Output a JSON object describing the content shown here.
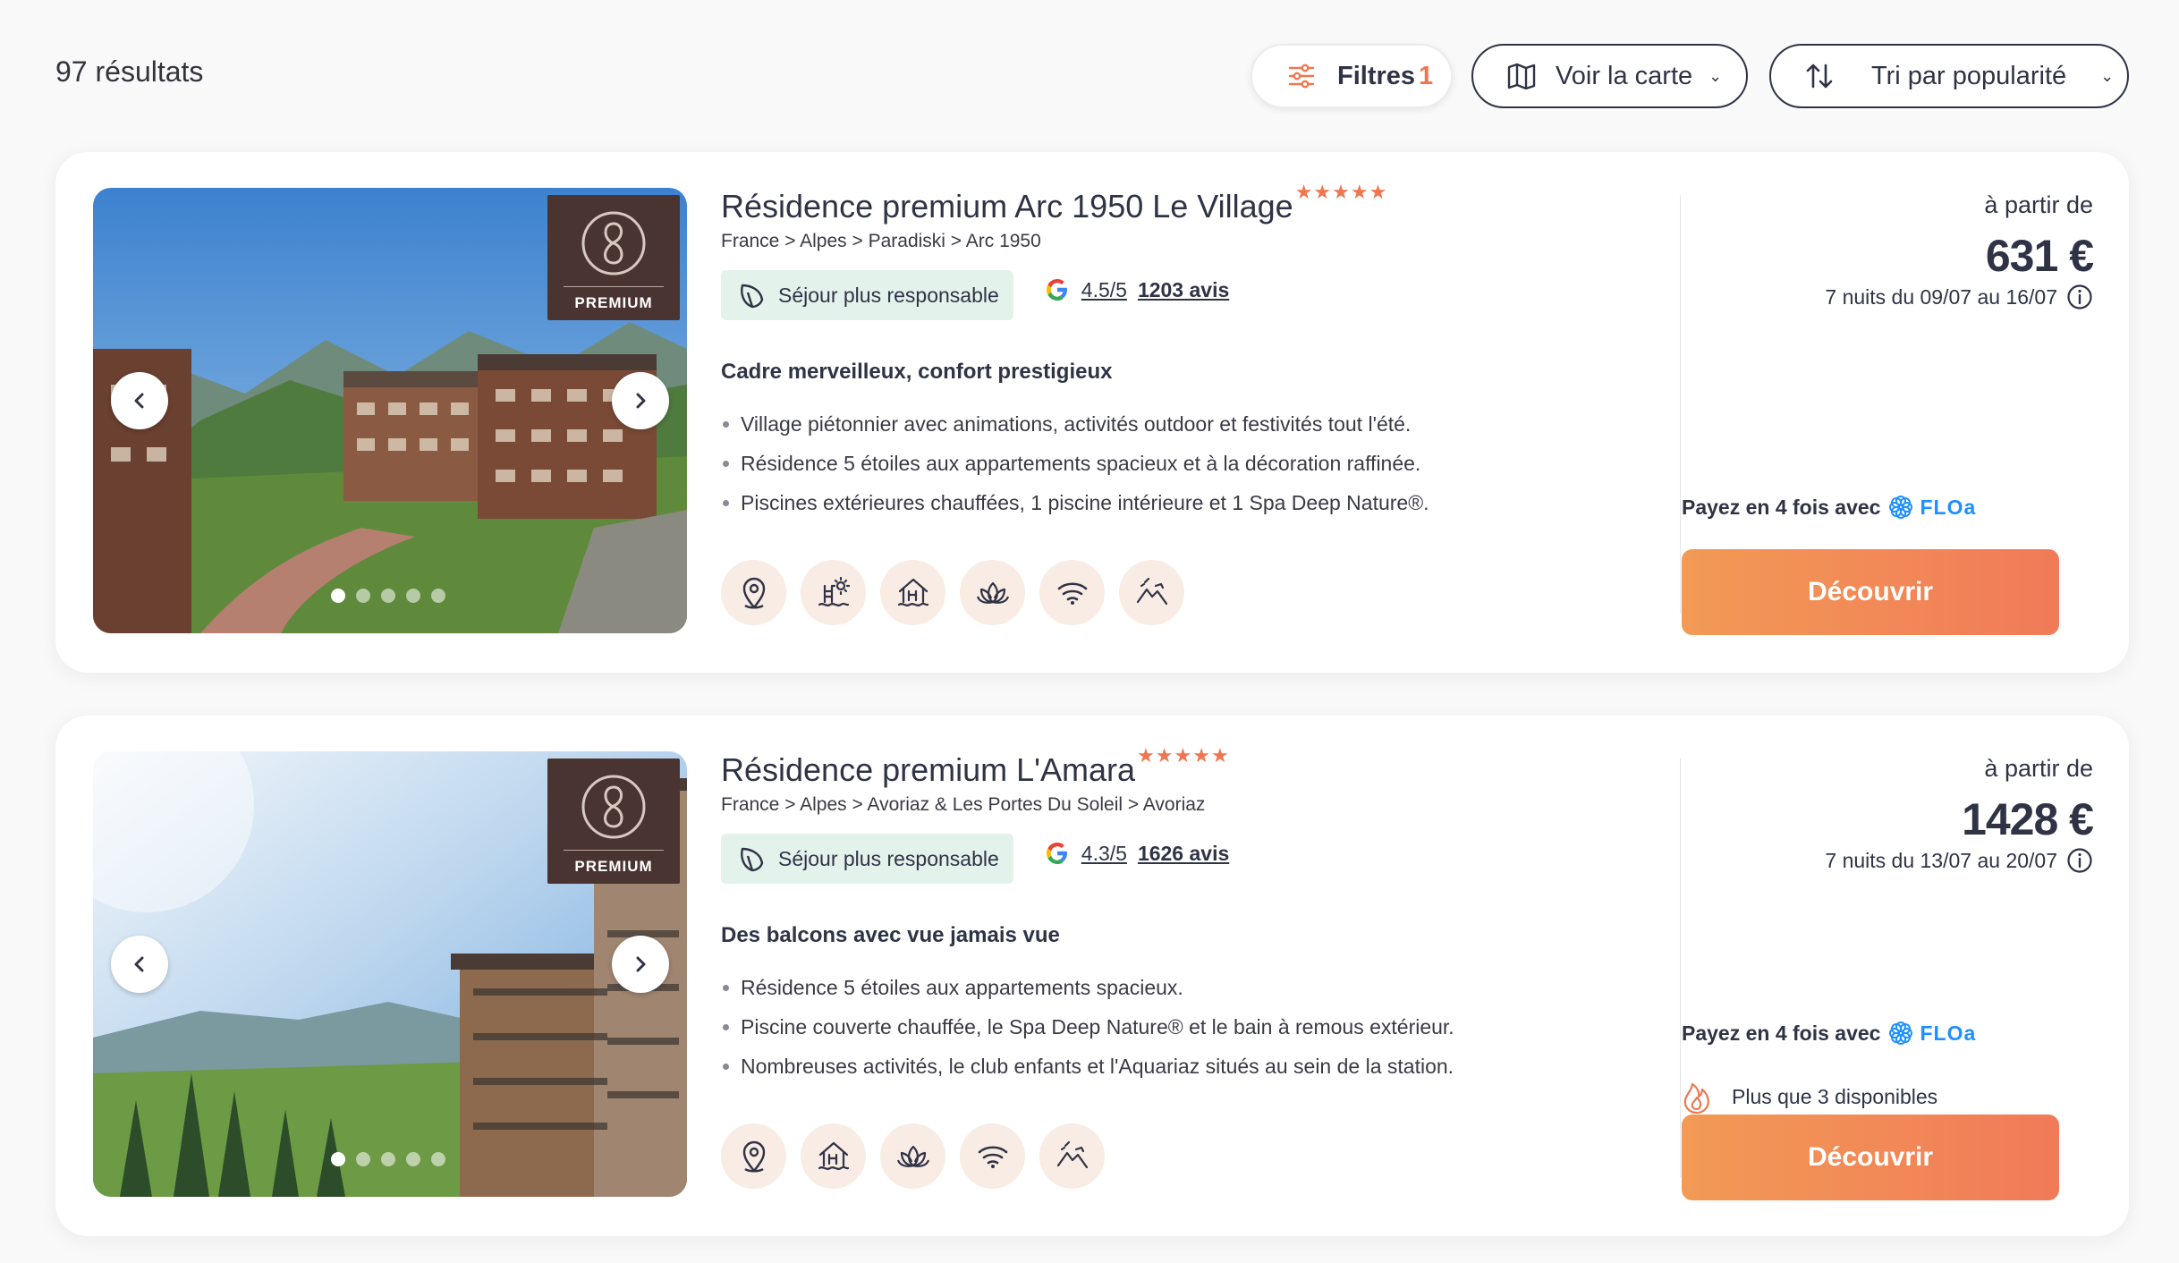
{
  "results": {
    "count_label": "97 résultats"
  },
  "toolbar": {
    "filters_label": "Filtres",
    "filters_count": "1",
    "map_label": "Voir la carte",
    "sort_label": "Tri par popularité"
  },
  "colors": {
    "accent": "#f07650",
    "button_start": "#f29a56",
    "button_end": "#f17a58",
    "eco_bg": "#e3f3ec",
    "badge_bg": "#4a3431",
    "text": "#2f3345"
  },
  "cards": [
    {
      "badge": "PREMIUM",
      "title": "Résidence premium Arc 1950 Le Village",
      "stars": "★★★★★",
      "breadcrumb": "France > Alpes > Paradiski > Arc 1950",
      "eco_label": "Séjour plus responsable",
      "rating_score": "4.5/5",
      "rating_count": "1203 avis",
      "subtitle": "Cadre merveilleux, confort prestigieux",
      "bullets": [
        "Village piétonnier avec animations, activités outdoor et festivités tout l'été.",
        "Résidence 5 étoiles aux appartements spacieux et à la décoration raffinée.",
        "Piscines extérieures chauffées, 1 piscine intérieure et 1 Spa Deep Nature®."
      ],
      "amenities": [
        "location-pin-icon",
        "pool-sun-icon",
        "house-pool-icon",
        "lotus-spa-icon",
        "wifi-icon",
        "hiking-icon"
      ],
      "from_label": "à partir de",
      "price": "631 €",
      "nights": "7 nuits du 09/07 au 16/07",
      "floa_label": "Payez en 4 fois avec",
      "floa_brand": "FLOa",
      "cta": "Découvrir"
    },
    {
      "badge": "PREMIUM",
      "title": "Résidence premium L'Amara",
      "stars": "★★★★★",
      "breadcrumb": "France > Alpes > Avoriaz & Les Portes Du Soleil > Avoriaz",
      "eco_label": "Séjour plus responsable",
      "rating_score": "4.3/5",
      "rating_count": "1626 avis",
      "subtitle": "Des balcons avec vue jamais vue",
      "bullets": [
        "Résidence 5 étoiles aux appartements spacieux.",
        "Piscine couverte chauffée, le Spa Deep Nature® et le bain à remous extérieur.",
        "Nombreuses activités, le club enfants et l'Aquariaz situés au sein de la station."
      ],
      "amenities": [
        "location-pin-icon",
        "house-pool-icon",
        "lotus-spa-icon",
        "wifi-icon",
        "hiking-icon"
      ],
      "from_label": "à partir de",
      "price": "1428 €",
      "nights": "7 nuits du 13/07 au 20/07",
      "floa_label": "Payez en 4 fois avec",
      "floa_brand": "FLOa",
      "availability": "Plus que 3 disponibles",
      "cta": "Découvrir"
    }
  ]
}
